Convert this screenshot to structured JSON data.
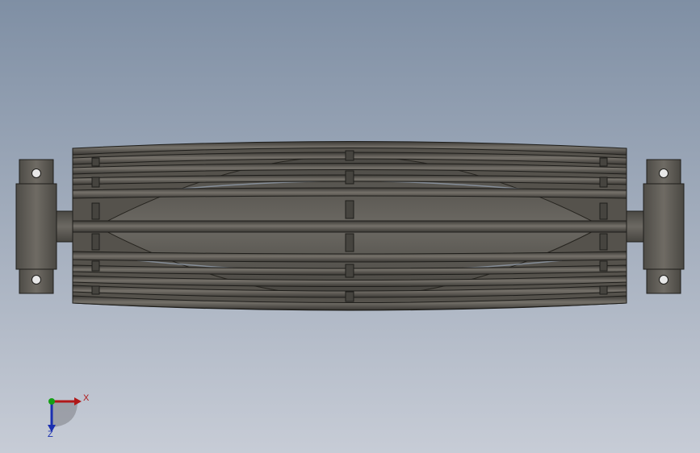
{
  "viewport": {
    "model": "drum-roller-assembly",
    "colors": {
      "background_top": "#7f8fa4",
      "background_bottom": "#c7ccd6",
      "part_dark": "#3d3b36",
      "part_mid": "#5b5852",
      "part_light": "#77736b",
      "edge": "#1f1e1b"
    }
  },
  "triad": {
    "x_label": "X",
    "z_label": "Z",
    "x_color": "#b01818",
    "y_color": "#14a014",
    "z_color": "#1a2fb0"
  }
}
